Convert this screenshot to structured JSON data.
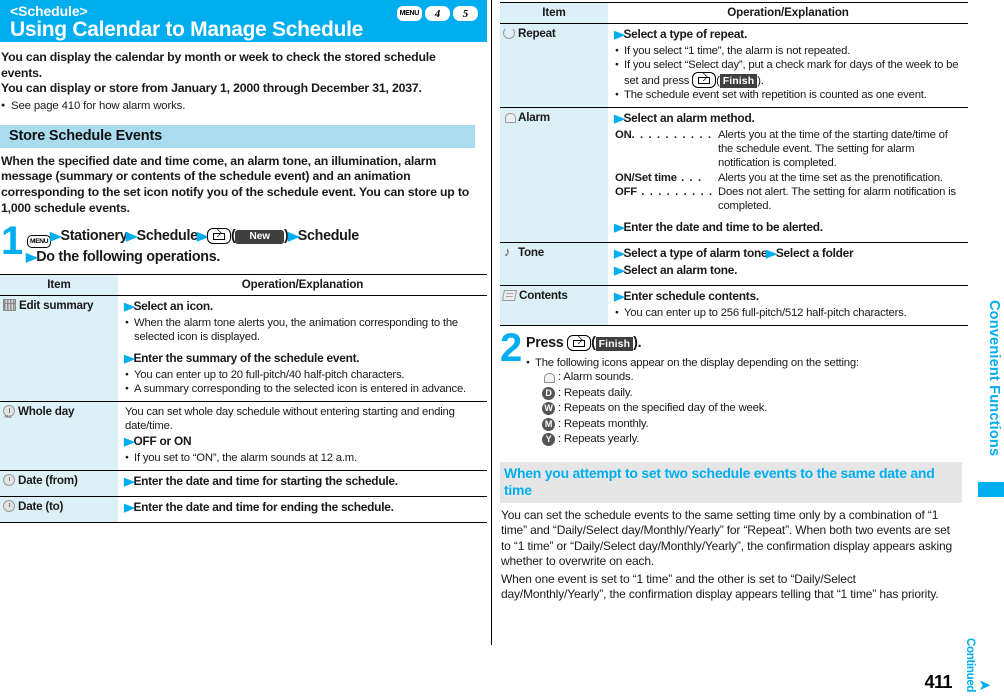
{
  "header": {
    "subtitle": "<Schedule>",
    "title": "Using Calendar to Manage Schedule",
    "keys": [
      "MENU",
      "4",
      "5"
    ]
  },
  "intro": {
    "line1": "You can display the calendar by month or week to check the stored schedule events.",
    "line2": "You can display or store from January 1, 2000 through December 31, 2037.",
    "note": "See page 410 for how alarm works."
  },
  "section": {
    "heading": "Store Schedule Events",
    "paragraph": "When the specified date and time come, an alarm tone, an illumination, alarm message (summary or contents of the schedule event) and an animation corresponding to the set icon notify you of the schedule event. You can store up to 1,000 schedule events."
  },
  "step1": {
    "number": "1",
    "menu_key": "MENU",
    "nav1": "Stationery",
    "nav2": "Schedule",
    "badge": "New",
    "nav3": "Schedule",
    "line2": "Do the following operations."
  },
  "table_left": {
    "col_item": "Item",
    "col_ops": "Operation/Explanation",
    "rows": [
      {
        "icon": "calendar-icon",
        "item": "Edit summary",
        "blocks": [
          {
            "type": "head",
            "text": "Select an icon."
          },
          {
            "type": "note",
            "text": "When the alarm tone alerts you, the animation corresponding to the selected icon is displayed."
          },
          {
            "type": "gap"
          },
          {
            "type": "head",
            "text": "Enter the summary of the schedule event."
          },
          {
            "type": "note",
            "text": "You can enter up to 20 full-pitch/40 half-pitch characters."
          },
          {
            "type": "note",
            "text": "A summary corresponding to the selected icon is entered in advance."
          }
        ]
      },
      {
        "icon": "clock-all-icon",
        "item": "Whole day",
        "blocks": [
          {
            "type": "plain",
            "text": "You can set whole day schedule without entering starting and ending date/time."
          },
          {
            "type": "head",
            "text": "OFF or ON"
          },
          {
            "type": "note",
            "text": "If you set to “ON”, the alarm sounds at 12 a.m."
          }
        ]
      },
      {
        "icon": "clock-icon",
        "item": "Date (from)",
        "blocks": [
          {
            "type": "head",
            "text": "Enter the date and time for starting the schedule."
          }
        ]
      },
      {
        "icon": "clock-icon",
        "item": "Date (to)",
        "blocks": [
          {
            "type": "head",
            "text": "Enter the date and time for ending the schedule."
          }
        ]
      }
    ]
  },
  "table_right": {
    "col_item": "Item",
    "col_ops": "Operation/Explanation",
    "rows": [
      {
        "icon": "repeat-icon",
        "item": "Repeat",
        "blocks": [
          {
            "type": "head",
            "text": "Select a type of repeat."
          },
          {
            "type": "note",
            "text": "If you select “1 time”, the alarm is not repeated."
          },
          {
            "type": "note_finish",
            "text_before": "If you select “Select day”, put a check mark for days of the week to be set and press ",
            "badge": "Finish",
            "text_after": ")."
          },
          {
            "type": "note",
            "text": "The schedule event set with repetition is counted as one event."
          }
        ]
      },
      {
        "icon": "bell-icon",
        "item": "Alarm",
        "blocks": [
          {
            "type": "head",
            "text": "Select an alarm method."
          },
          {
            "type": "dl",
            "term": "ON",
            "leader": ". . . . . . . . . . ",
            "desc": "Alerts you at the time of the starting date/time of the schedule event. The setting for alarm notification is completed."
          },
          {
            "type": "dl",
            "term": "ON/Set time",
            "leader": " . . . ",
            "desc": "Alerts you at the time set as the prenotification."
          },
          {
            "type": "dl",
            "term": "OFF",
            "leader": " . . . . . . . . . ",
            "desc": "Does not alert. The setting for alarm notification is completed."
          },
          {
            "type": "gap"
          },
          {
            "type": "head",
            "text": "Enter the date and time to be alerted."
          }
        ]
      },
      {
        "icon": "music-note-icon",
        "item": "Tone",
        "blocks": [
          {
            "type": "head2",
            "text_a": "Select a type of alarm tone",
            "text_b": "Select a folder"
          },
          {
            "type": "head",
            "text": "Select an alarm tone."
          }
        ]
      },
      {
        "icon": "memo-icon",
        "item": "Contents",
        "blocks": [
          {
            "type": "head",
            "text": "Enter schedule contents."
          },
          {
            "type": "note",
            "text": "You can enter up to 256 full-pitch/512 half-pitch characters."
          }
        ]
      }
    ]
  },
  "step2": {
    "number": "2",
    "press_label": "Press",
    "badge": "Finish",
    "trailing": ").",
    "note": "The following icons appear on the display depending on the setting:",
    "legend": [
      {
        "glyph": "bell",
        "label": ": Alarm sounds."
      },
      {
        "glyph": "D",
        "label": ": Repeats daily."
      },
      {
        "glyph": "W",
        "label": ": Repeats on the specified day of the week."
      },
      {
        "glyph": "M",
        "label": ": Repeats monthly."
      },
      {
        "glyph": "Y",
        "label": ": Repeats yearly."
      }
    ]
  },
  "subsection": {
    "heading": "When you attempt to set two schedule events to the same date and time",
    "para1": "You can set the schedule events to the same setting time only by a combination of “1 time” and “Daily/Select day/Monthly/Yearly” for “Repeat”. When both two events are set to “1 time” or “Daily/Select day/Monthly/Yearly”, the confirmation display appears asking whether to overwrite on each.",
    "para2": "When one event is set to “1 time” and the other is set to “Daily/Select day/Monthly/Yearly”, the confirmation display appears telling that “1 time” has priority."
  },
  "side_tab": {
    "label": "Convenient Functions"
  },
  "footer": {
    "page_number": "411",
    "continued": "Continued",
    "arrow": "➤"
  },
  "colors": {
    "brand_cyan": "#00aeef",
    "section_blue": "#aadcf0",
    "table_blue": "#dcf0f8",
    "subhead_gray": "#e6e6e6",
    "badge_dark": "#3f3f3f"
  }
}
